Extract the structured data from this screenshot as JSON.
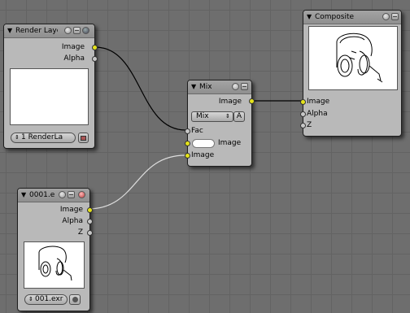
{
  "colors": {
    "socket_image": "#e4e21a",
    "socket_value": "#c8c8c8",
    "node_bg": "#b9b9b9",
    "grid_bg": "#6e6e6e"
  },
  "render_layers": {
    "title": "Render Laye",
    "outputs": [
      "Image",
      "Alpha"
    ],
    "layer_select": "1 RenderLa",
    "icons": [
      "expand-icon",
      "minimize-icon",
      "preview-icon",
      "scene-icon"
    ]
  },
  "mix": {
    "title": "Mix",
    "output": "Image",
    "blend_mode": "Mix",
    "alpha_button": "A",
    "inputs": [
      "Fac",
      "Image",
      "Image"
    ]
  },
  "composite": {
    "title": "Composite",
    "inputs": [
      "Image",
      "Alpha",
      "Z"
    ],
    "preview_subject": "headset-line-art"
  },
  "image": {
    "title": "0001.e",
    "outputs": [
      "Image",
      "Alpha",
      "Z"
    ],
    "file": "001.exr"
  }
}
